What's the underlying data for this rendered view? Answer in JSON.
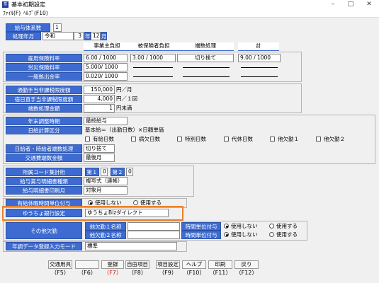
{
  "window": {
    "title": "基本初期設定",
    "icon": "app-icon"
  },
  "menu": {
    "items": [
      "ﾌｧｲﾙ(F)",
      "ﾍﾙﾌﾟ(F10)"
    ]
  },
  "system": {
    "label": "給与体系数",
    "value": "1"
  },
  "period": {
    "label": "処理年月",
    "era": "令和",
    "year": "3",
    "year_unit": "年",
    "month": "12",
    "month_unit": "月"
  },
  "insurance": {
    "headers": [
      "事業主負担",
      "被保険者負担",
      "端数処理",
      "計"
    ],
    "rows": [
      {
        "label": "雇用保険料率",
        "employer": "6.00 / 1000",
        "employee": "3.00 / 1000",
        "rounding": "切り捨て",
        "total": "9.00 / 1000"
      },
      {
        "label": "労災保険料率",
        "employer": "5.000/ 1000"
      },
      {
        "label": "一般拠出金率",
        "employer": "0.020/ 1000"
      }
    ]
  },
  "limits": [
    {
      "label": "通勤手当非課税限度額",
      "value": "150,000",
      "unit": "円／月"
    },
    {
      "label": "宿日直手当非課税限度額",
      "value": "4,000",
      "unit": "円／１回"
    },
    {
      "label": "端数処理金額",
      "value": "1",
      "unit": "円未満"
    }
  ],
  "misc": {
    "adjust": {
      "label": "年末調整時期",
      "value": "最終給与"
    },
    "daily": {
      "label": "日給計算区分",
      "formula": "基本給＝（出勤日数）×日額単価",
      "checkboxes": [
        "有給日数",
        "病欠日数",
        "特別日数",
        "代休日数",
        "他欠勤１",
        "他欠勤２"
      ]
    },
    "rounding_daily": {
      "label": "日給者・時給者端数処理",
      "value": "切り捨て"
    },
    "transit_rounding": {
      "label": "交通費端数金額",
      "value": "最後月"
    }
  },
  "codes": {
    "label": "所属コード集計桁",
    "first": "第１",
    "first_v": "0",
    "second": "第２",
    "second_v": "0"
  },
  "slip": {
    "label": "給与賞与明細書種類",
    "value": "複写式（連帳）"
  },
  "slip_month": {
    "label": "給与明細書印刷月",
    "value": "対象月"
  },
  "leave": {
    "label": "有給休暇時間単位付与",
    "options": [
      "使用しない",
      "使用する"
    ],
    "selected": 0
  },
  "bank": {
    "label": "ゆうちょ銀行設定",
    "value": "ゆうちょBizダイレクト"
  },
  "other_leave": {
    "label": "その他欠勤",
    "name1_label": "他欠勤１名称",
    "name2_label": "他欠勤２名称",
    "time_label": "時間単位付与",
    "options": [
      "使用しない",
      "使用する"
    ]
  },
  "yearend": {
    "label": "年調データ登録入力モード",
    "value": "標準"
  },
  "footer": {
    "buttons": [
      {
        "label": "交通用具",
        "key": "（F5）"
      },
      {
        "label": "",
        "key": "（F6）"
      },
      {
        "label": "登録",
        "key": "（F7）"
      },
      {
        "label": "自由項目",
        "key": "（F8）"
      },
      {
        "label": "項目設定",
        "key": "（F9）"
      },
      {
        "label": "ヘルプ",
        "key": "（F10）"
      },
      {
        "label": "印刷",
        "key": "（F11）"
      },
      {
        "label": "戻り",
        "key": "（F12）"
      }
    ]
  },
  "colors": {
    "label_bg": "#3d6bd1",
    "highlight": "#e8822d",
    "key_active": "#d11b1b"
  }
}
